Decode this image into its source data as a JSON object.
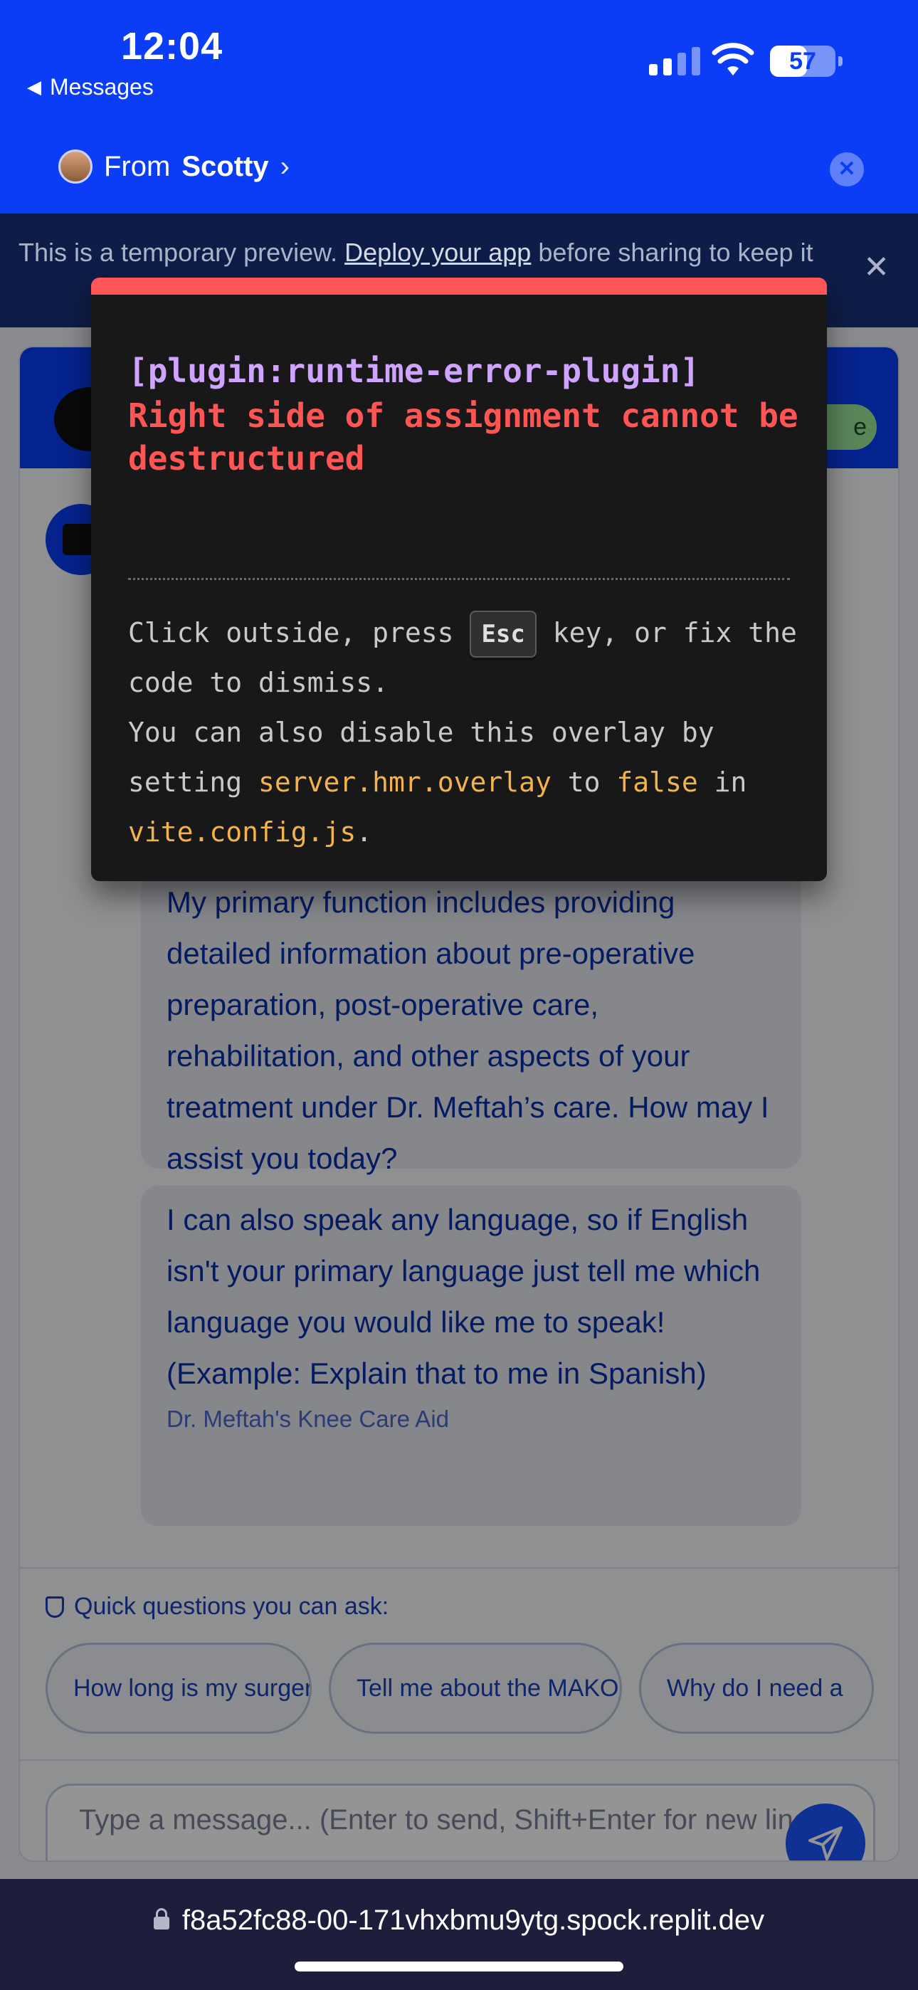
{
  "status": {
    "time": "12:04",
    "back_label": "Messages",
    "battery": "57",
    "battery_level": 0.57
  },
  "header": {
    "from_prefix": "From",
    "from_name": "Scotty"
  },
  "banner": {
    "text_before": "This is a temporary preview. ",
    "link": "Deploy your app",
    "text_after": " before sharing to keep it"
  },
  "app": {
    "status_pill": "e",
    "bubble1": "My primary function includes providing detailed information about pre-operative preparation, post-operative care, rehabilitation, and other aspects of your treatment under Dr. Meftah’s care. How may I assist you today?",
    "bubble2": "I can also speak any language, so if English isn't your primary language just tell me which language you would like me to speak! (Example: Explain that to me in Spanish)",
    "sender": "Dr. Meftah's Knee Care Aid",
    "quick_title": "Quick questions you can ask:",
    "quick": [
      "How long is my surgery going to take?",
      "Tell me about the MAKO Robotic Technique",
      "Why do I need a"
    ],
    "input_placeholder": "Type a message... (Enter to send, Shift+Enter for new line)"
  },
  "overlay": {
    "plugin": "[plugin:runtime-error-plugin]",
    "message": "Right side of assignment cannot be destructured",
    "tip_1": "Click outside, press ",
    "tip_key": "Esc",
    "tip_2": " key, or fix the code to dismiss.",
    "tip_3": "You can also disable this overlay by setting ",
    "tip_code1": "server.hmr.overlay",
    "tip_4": " to ",
    "tip_code2": "false",
    "tip_5": " in ",
    "tip_code3": "vite.config.js",
    "tip_6": "."
  },
  "urlbar": {
    "url": "f8a52fc88-00-171vhxbmu9ytg.spock.replit.dev"
  },
  "colors": {
    "status_blue": "#0a3df5",
    "overlay_red": "#ff5555",
    "plugin_purple": "#cfa4ff",
    "code_yellow": "#f3b24a"
  }
}
